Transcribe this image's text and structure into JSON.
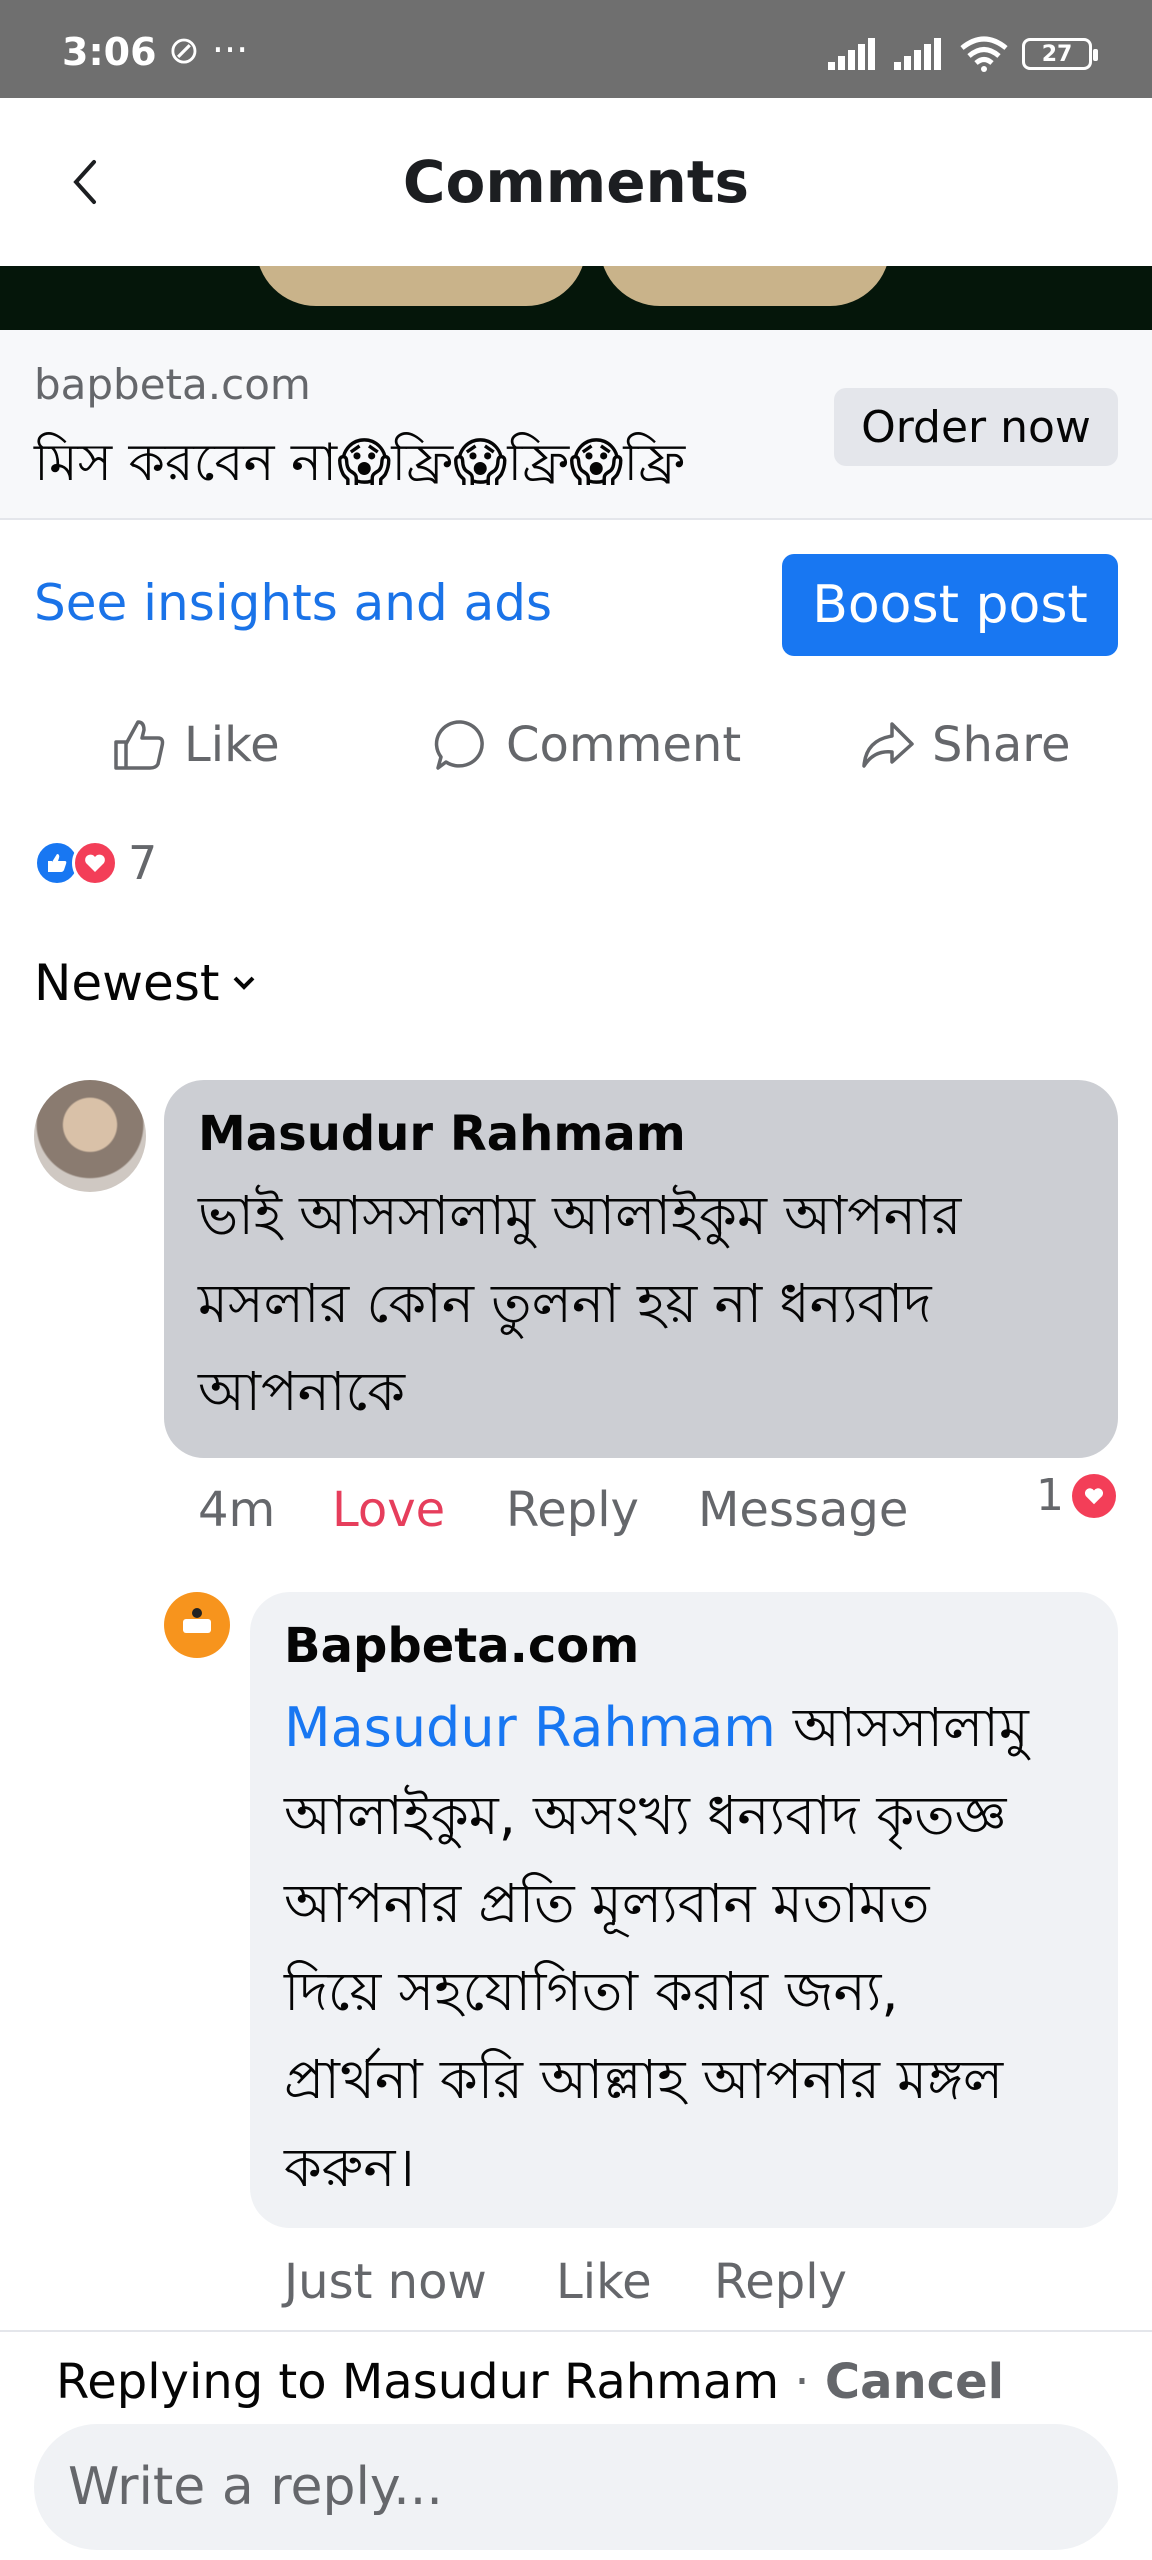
{
  "status": {
    "time": "3:06",
    "extra": "⊘ ···",
    "battery": "27"
  },
  "header": {
    "title": "Comments"
  },
  "ad": {
    "domain": "bapbeta.com",
    "headline": "মিস করবেন না😱ফ্রি😱ফ্রি😱ফ্রি",
    "order_label": "Order now"
  },
  "promo": {
    "insights_label": "See insights and ads",
    "boost_label": "Boost post"
  },
  "actions": {
    "like": "Like",
    "comment": "Comment",
    "share": "Share"
  },
  "reactions": {
    "count": "7"
  },
  "sort": {
    "label": "Newest"
  },
  "comment": {
    "author": "Masudur Rahmam",
    "lines": [
      "ভাই আসসালামু আলাইকুম আপনার",
      "মসলার কোন তুলনা হয় না ধন্যবাদ",
      "আপনাকে"
    ],
    "time": "4m",
    "reaction_label": "Love",
    "reply_label": "Reply",
    "message_label": "Message",
    "love_count": "1"
  },
  "reply": {
    "author": "Bapbeta.com",
    "mention": "Masudur Rahmam",
    "first_line_rest": " আসসালামু",
    "lines": [
      "আলাইকুম, অসংখ্য ধন্যবাদ কৃতজ্ঞ",
      "আপনার প্রতি মূল্যবান মতামত",
      "দিয়ে সহযোগিতা করার জন্য,",
      "প্রার্থনা করি আল্লাহ আপনার মঙ্গল",
      "করুন।"
    ],
    "time": "Just now",
    "like_label": "Like",
    "reply_label": "Reply"
  },
  "composer": {
    "replying_prefix": "Replying to ",
    "replying_name": "Masudur Rahmam",
    "separator": " · ",
    "cancel_label": "Cancel",
    "placeholder": "Write a reply..."
  }
}
